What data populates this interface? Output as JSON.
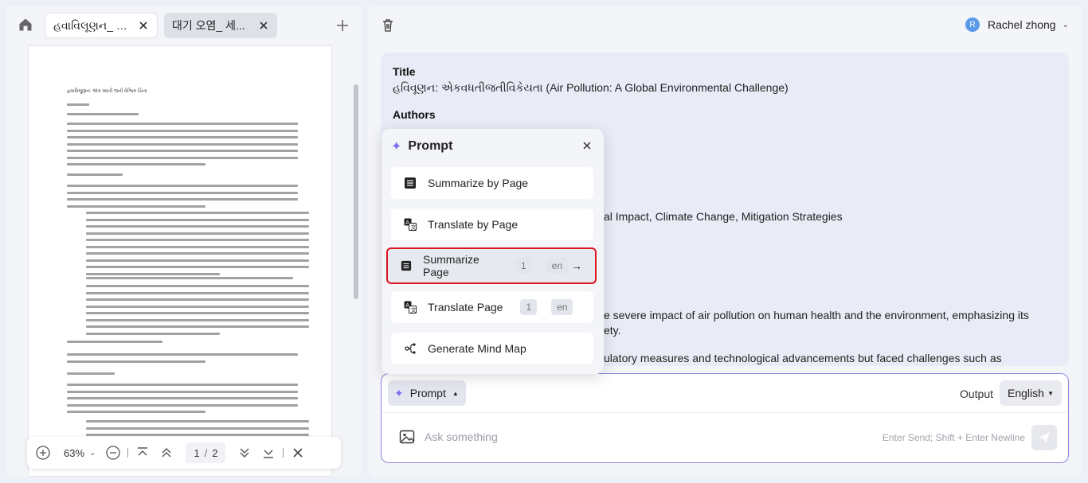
{
  "tabs": [
    {
      "label": "હવાવિલૂણન_ એ..."
    },
    {
      "label": "대기 오염_ 세..."
    }
  ],
  "pdf": {
    "title": "હવાવિલૂણન: એક વધતી જતી વૈશ્વિક ચિંતા"
  },
  "zoom": {
    "value": "63%",
    "page_current": "1",
    "page_sep": "/",
    "page_total": "2"
  },
  "user": {
    "initial": "R",
    "name": "Rachel zhong"
  },
  "summary": {
    "title_label": "Title",
    "title_value": "હવિવૂણન: એકવધતીજતીવિકેયતા (Air Pollution: A Global Environmental Challenge)",
    "authors_label": "Authors",
    "keywords_partial": "al Impact, Climate Change, Mitigation Strategies",
    "body_line1": "e severe impact of air pollution on human health and the environment, emphasizing its",
    "body_line2": "ety.",
    "body_line3": "ulatory measures and technological advancements but faced challenges such as"
  },
  "popup": {
    "title": "Prompt",
    "items": [
      {
        "label": "Summarize by Page",
        "icon": "list-icon"
      },
      {
        "label": "Translate by Page",
        "icon": "translate-icon"
      },
      {
        "label": "Summarize Page",
        "icon": "list-icon",
        "page": "1",
        "lang": "en"
      },
      {
        "label": "Translate Page",
        "icon": "translate-icon",
        "page": "1",
        "lang": "en"
      },
      {
        "label": "Generate Mind Map",
        "icon": "mindmap-icon"
      }
    ]
  },
  "input": {
    "prompt_label": "Prompt",
    "output_label": "Output",
    "output_lang": "English",
    "placeholder": "Ask something",
    "hint": "Enter Send; Shift + Enter Newline"
  },
  "colors": {
    "accent": "#7a6ff0",
    "highlight_border": "#e0141e",
    "input_border": "#8b84e0"
  }
}
